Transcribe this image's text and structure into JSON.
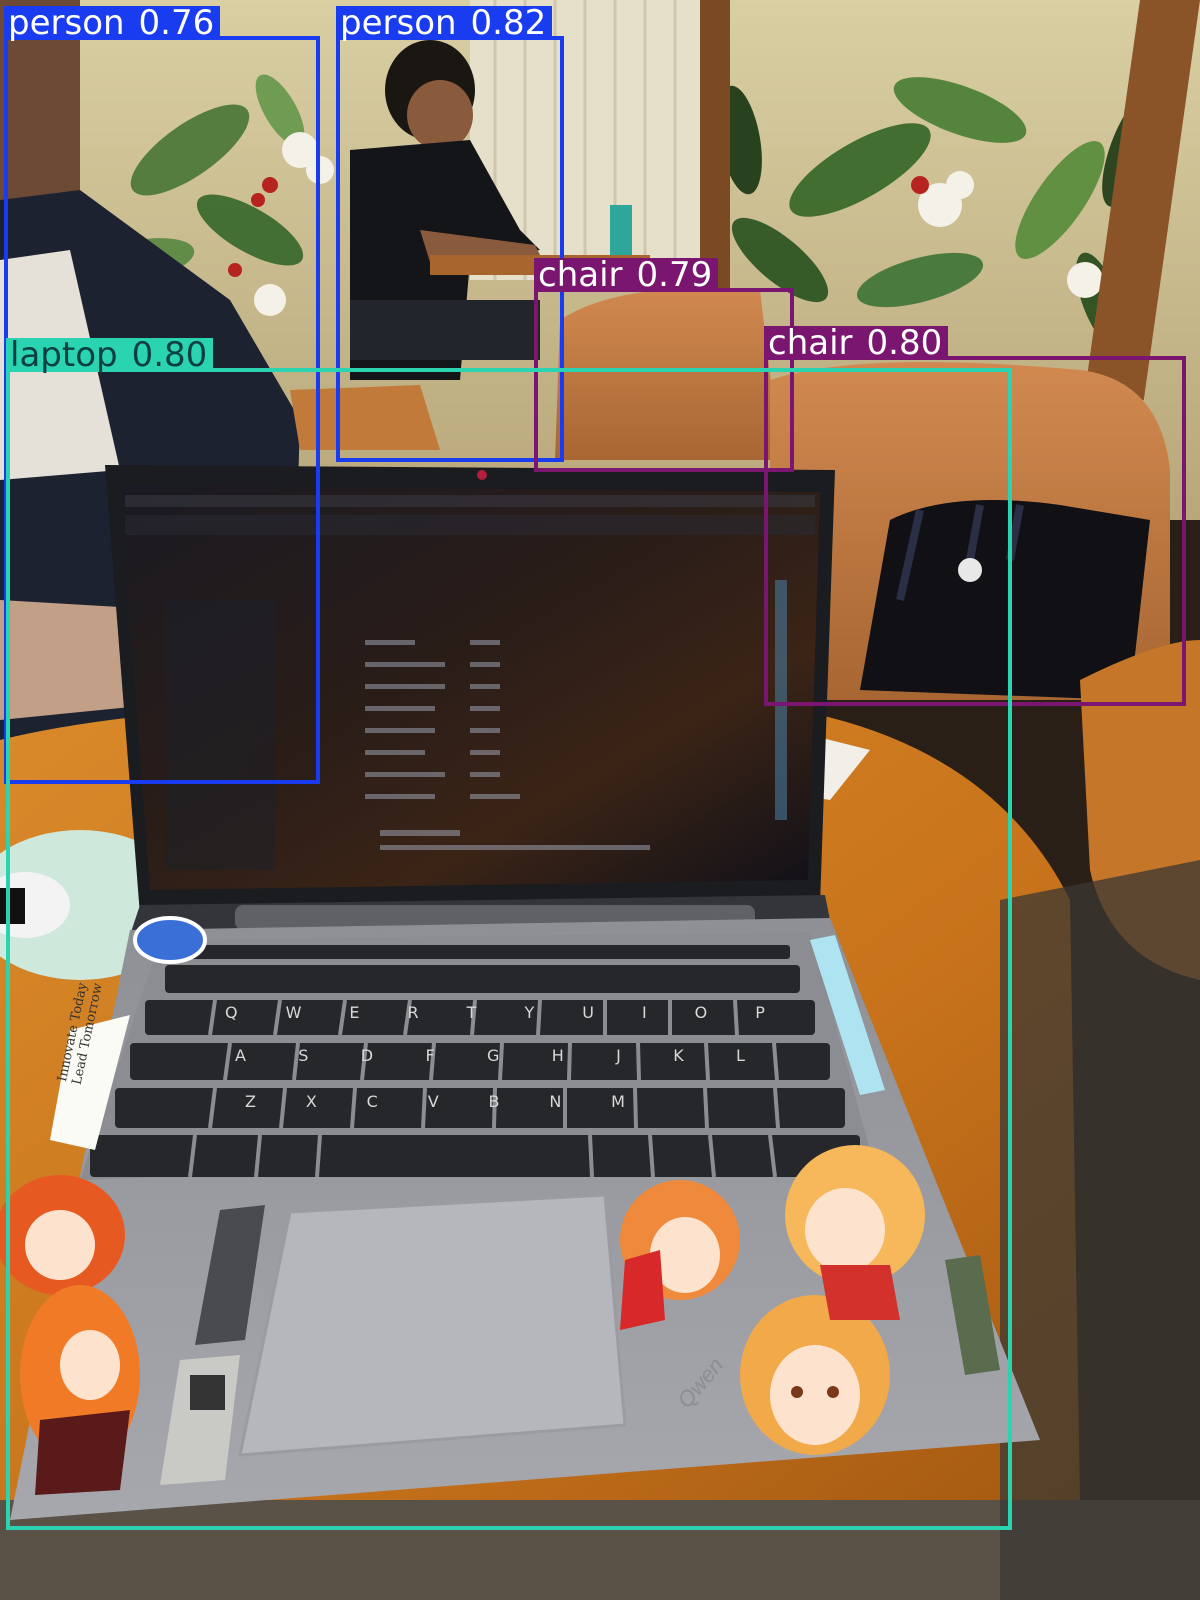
{
  "image": {
    "description_free": true,
    "colors": {
      "person_box": "#1a3cf0",
      "laptop_box": "#2ad4b0",
      "chair_box": "#7a1670",
      "laptop_label_text": "#0b3f45",
      "label_text": "#ffffff"
    }
  },
  "detections": [
    {
      "class": "person",
      "score": "0.76",
      "color": "#1a3cf0"
    },
    {
      "class": "person",
      "score": "0.82",
      "color": "#1a3cf0"
    },
    {
      "class": "chair",
      "score": "0.79",
      "color": "#7a1670"
    },
    {
      "class": "chair",
      "score": "0.80",
      "color": "#7a1670"
    },
    {
      "class": "laptop",
      "score": "0.80",
      "color": "#2ad4b0"
    }
  ],
  "stickers": {
    "innovate": "Innovate Today Lead Tomorrow",
    "qwen": "Qwen"
  },
  "keyboard": {
    "row1": [
      "Q",
      "W",
      "E",
      "R",
      "T",
      "Y",
      "U",
      "I",
      "O",
      "P"
    ],
    "row2": [
      "A",
      "S",
      "D",
      "F",
      "G",
      "H",
      "J",
      "K",
      "L"
    ],
    "row3": [
      "Z",
      "X",
      "C",
      "V",
      "B",
      "N",
      "M"
    ]
  }
}
